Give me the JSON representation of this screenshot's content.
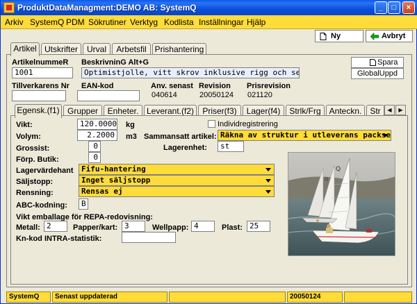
{
  "window": {
    "title": "ProduktDataManagment:DEMO AB: SystemQ"
  },
  "menu": [
    "Arkiv",
    "SystemQ",
    "PDM",
    "Sökrutiner",
    "Verktyg",
    "Kodlista",
    "Inställningar",
    "Hjälp"
  ],
  "toolbar": {
    "new_label": "Ny",
    "cancel_label": "Avbryt"
  },
  "main_tabs": [
    "Artikel",
    "Utskrifter",
    "Urval",
    "Arbetsfil",
    "Prishantering"
  ],
  "article": {
    "number_label": "ArtikelnummeR",
    "number_value": "1001",
    "description_label": "BeskrivninG Alt+G",
    "description_value": "Optimistjolle, vitt skrov inklusive rigg och segel",
    "save_label": "Spara",
    "global_label": "GlobalUppd",
    "mfr_no_label": "Tillverkarens Nr",
    "mfr_no_value": "",
    "ean_label": "EAN-kod",
    "ean_value": "",
    "last_used_label": "Anv. senast",
    "last_used_value": "040614",
    "revision_label": "Revision",
    "revision_value": "20050124",
    "price_rev_label": "Prisrevision",
    "price_rev_value": "021120"
  },
  "sub_tabs": [
    "Egensk.(f1)",
    "Grupper",
    "Enheter.",
    "Leverant.(f2)",
    "Priser(f3)",
    "Lager(f4)",
    "Strlk/Frg",
    "Anteckn.",
    "Str"
  ],
  "props": {
    "weight_label": "Vikt:",
    "weight_value": "120.0000",
    "weight_unit": "kg",
    "volume_label": "Volym:",
    "volume_value": "2.2000",
    "volume_unit": "m3",
    "wholesaler_label": "Grossist:",
    "wholesaler_value": "0",
    "pack_label": "Förp. Butik:",
    "pack_value": "0",
    "individual_label": "Individregistrering",
    "individual_checked": false,
    "composite_label": "Sammansatt artikel:",
    "composite_value": "Räkna av struktur i utleverans packsedel",
    "stock_unit_label": "Lagerenhet:",
    "stock_unit_value": "st",
    "stock_value_label": "Lagervärdehant",
    "stock_value_value": "Fifu-hantering",
    "sales_stop_label": "Säljstopp:",
    "sales_stop_value": "Inget säljstopp",
    "cleaning_label": "Rensning:",
    "cleaning_value": "Rensas ej",
    "abc_label": "ABC-kodning:",
    "abc_value": "B",
    "repa_label": "Vikt emballage för REPA-redovisning:",
    "metal_label": "Metall:",
    "metal_value": "2",
    "paper_label": "Papper/kart:",
    "paper_value": "3",
    "cardboard_label": "Wellpapp:",
    "cardboard_value": "4",
    "plastic_label": "Plast:",
    "plastic_value": "25",
    "intrastat_label": "Kn-kod INTRA-statistik:",
    "intrastat_value": ""
  },
  "status": {
    "app": "SystemQ",
    "message": "Senast uppdaterad",
    "empty1": "",
    "date": "20050124",
    "empty2": ""
  },
  "colors": {
    "menu_bg": "#ffdc3a",
    "title_bg": "#0a4fd8",
    "combo_bg": "#ffdc3a",
    "window_bg": "#ece9d8"
  },
  "icons": {
    "new": "new-document-icon",
    "cancel": "green-arrow-icon",
    "save": "save-document-icon"
  }
}
